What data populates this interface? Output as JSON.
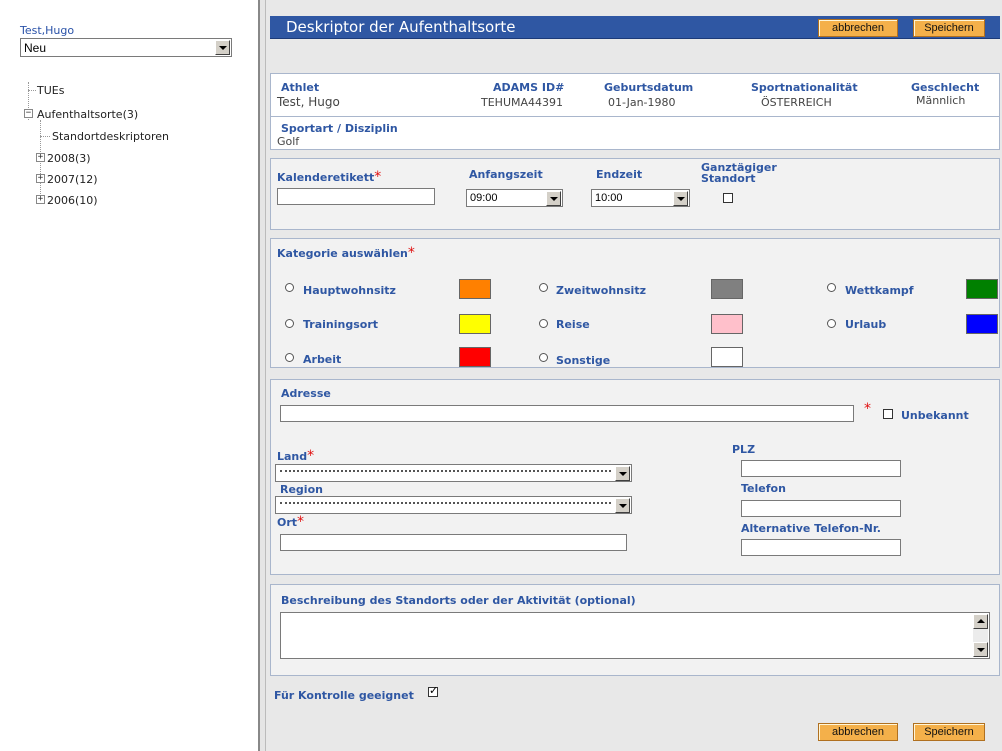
{
  "sidebar": {
    "user": "Test,Hugo",
    "new_select": "Neu",
    "tree": {
      "tues": "TUEs",
      "whereabouts": "Aufenthaltsorte(3)",
      "location_descriptors": "Standortdeskriptoren",
      "y2008": "2008(3)",
      "y2007": "2007(12)",
      "y2006": "2006(10)"
    }
  },
  "header": {
    "title": "Deskriptor der Aufenthaltsorte",
    "cancel": "abbrechen",
    "save": "Speichern"
  },
  "athlete": {
    "h_athlete": "Athlet",
    "name": "Test, Hugo",
    "h_adams": "ADAMS ID#",
    "adams_id": "TEHUMA44391",
    "h_birth": "Geburtsdatum",
    "birth": "01-Jan-1980",
    "h_nat": "Sportnationalität",
    "nat": "ÖSTERREICH",
    "h_gender": "Geschlecht",
    "gender": "Männlich",
    "h_sport": "Sportart / Disziplin",
    "sport": "Golf"
  },
  "timing": {
    "calendar_label": "Kalenderetikett",
    "start_label": "Anfangszeit",
    "start_value": "09:00",
    "end_label": "Endzeit",
    "end_value": "10:00",
    "allday_label_1": "Ganztägiger",
    "allday_label_2": "Standort",
    "required": "*"
  },
  "category": {
    "label": "Kategorie auswählen",
    "required": "*",
    "options": [
      {
        "label": "Hauptwohnsitz",
        "color": "#ff8000"
      },
      {
        "label": "Zweitwohnsitz",
        "color": "#808080"
      },
      {
        "label": "Wettkampf",
        "color": "#008000"
      },
      {
        "label": "Trainingsort",
        "color": "#ffff00"
      },
      {
        "label": "Reise",
        "color": "#ffc0cb"
      },
      {
        "label": "Urlaub",
        "color": "#0000ff"
      },
      {
        "label": "Arbeit",
        "color": "#ff0000"
      },
      {
        "label": "Sonstige",
        "color": "#ffffff"
      }
    ]
  },
  "address": {
    "label": "Adresse",
    "required": "*",
    "unknown": "Unbekannt",
    "country_label": "Land",
    "region_label": "Region",
    "city_label": "Ort",
    "zip_label": "PLZ",
    "phone_label": "Telefon",
    "alt_phone_label": "Alternative Telefon-Nr."
  },
  "description": {
    "label": "Beschreibung des Standorts oder der Aktivität (optional)"
  },
  "footer": {
    "eligible_label": "Für Kontrolle geeignet",
    "eligible_checked": true,
    "cancel": "abbrechen",
    "save": "Speichern"
  }
}
